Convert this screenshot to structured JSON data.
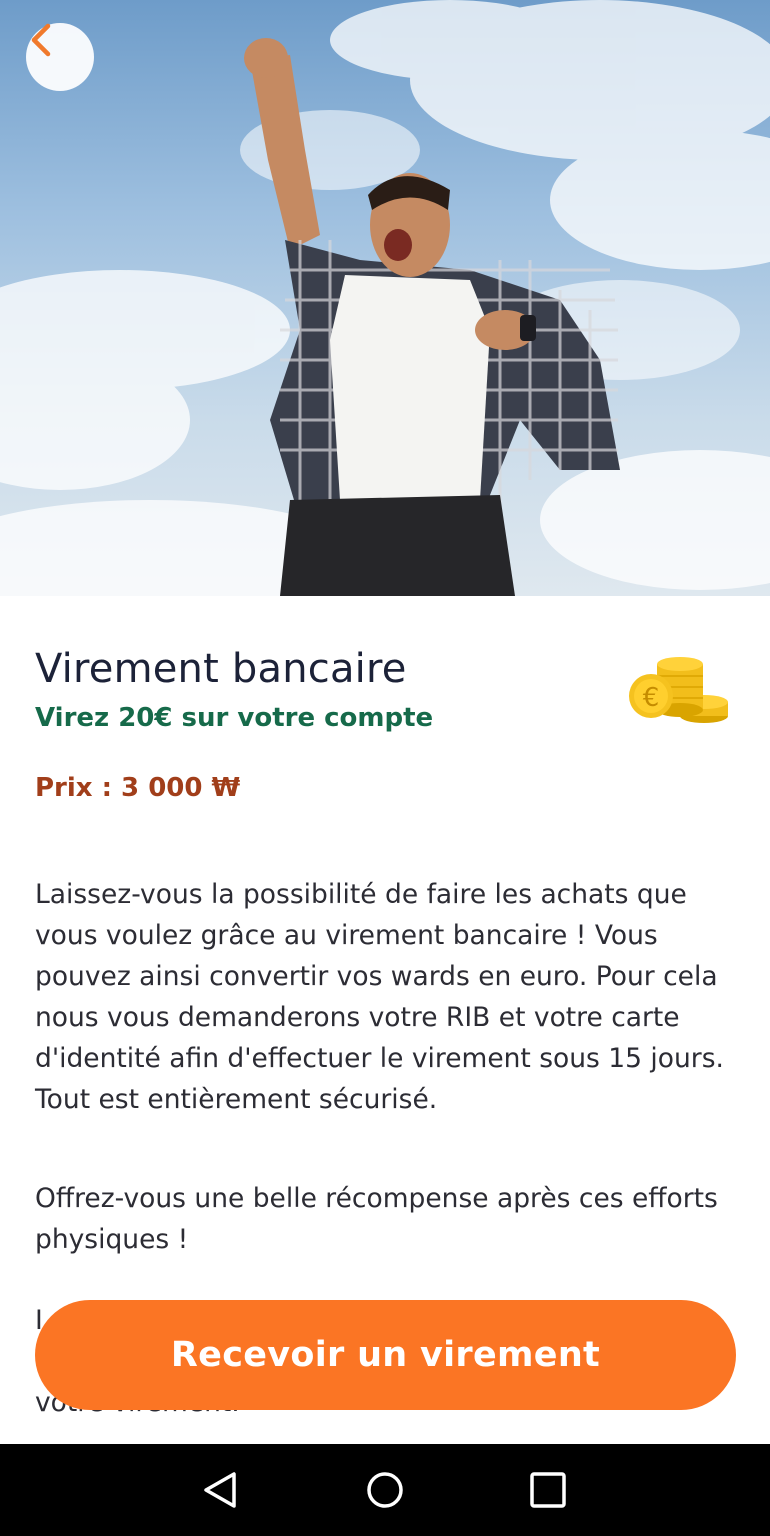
{
  "hero": {
    "image": "photo of a man jumping and cheering against a cloudy blue sky"
  },
  "header": {
    "back_icon": "chevron-left-icon",
    "accent": "#fb7524"
  },
  "reward": {
    "title": "Virement bancaire",
    "subtitle": "Virez 20€ sur votre compte",
    "price": "Prix : 3 000 ₩",
    "icon": "euro-coins-icon"
  },
  "description": {
    "paragraph1": "Laissez-vous la possibilité de faire les achats que vous voulez grâce au virement bancaire ! Vous pouvez ainsi convertir vos wards en euro. Pour cela nous vous demanderons votre RIB et votre carte d'identité afin d'effectuer le virement sous 15 jours. Tout est entièrement sécurisé.",
    "paragraph2": "Offrez-vous une belle récompense après ces efforts physiques !",
    "paragraph3_partial_line1": "I",
    "paragraph3_partial_line2": "e",
    "paragraph3_line3": "votre virement."
  },
  "cta": {
    "label": "Recevoir un virement",
    "color": "#fb7524"
  },
  "system_nav": {
    "back": "triangle-back-icon",
    "home": "circle-home-icon",
    "recents": "square-recents-icon"
  }
}
